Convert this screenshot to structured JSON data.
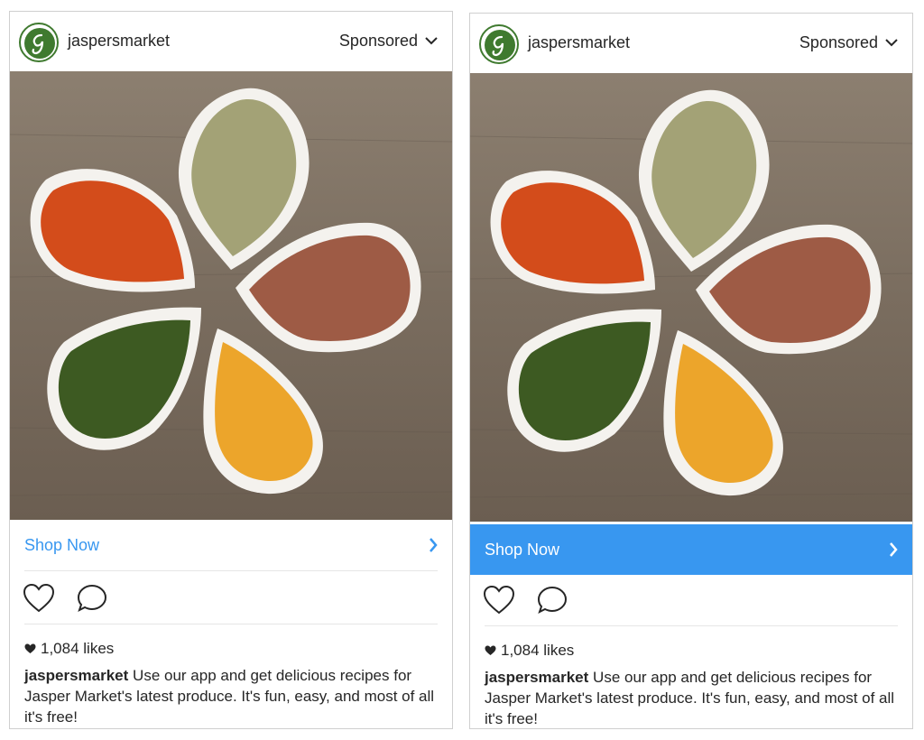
{
  "brand": {
    "color": "#3f7a2f",
    "link_color": "#3897f0"
  },
  "cards": [
    {
      "variant": "default",
      "username": "jaspersmarket",
      "sponsored": "Sponsored",
      "cta": "Shop Now",
      "likes": "1,084 likes",
      "caption_user": "jaspersmarket",
      "caption_text": "Use our app and get delicious recipes for Jasper Market's latest produce. It's fun, easy, and most of all it's free!"
    },
    {
      "variant": "highlighted",
      "username": "jaspersmarket",
      "sponsored": "Sponsored",
      "cta": "Shop Now",
      "likes": "1,084 likes",
      "caption_user": "jaspersmarket",
      "caption_text": "Use our app and get delicious recipes for Jasper Market's latest produce. It's fun, easy, and most of all it's free!"
    }
  ],
  "icons": [
    "logo-icon",
    "chevron-down-icon",
    "chevron-right-icon",
    "heart-icon",
    "comment-icon",
    "heart-filled-icon"
  ]
}
